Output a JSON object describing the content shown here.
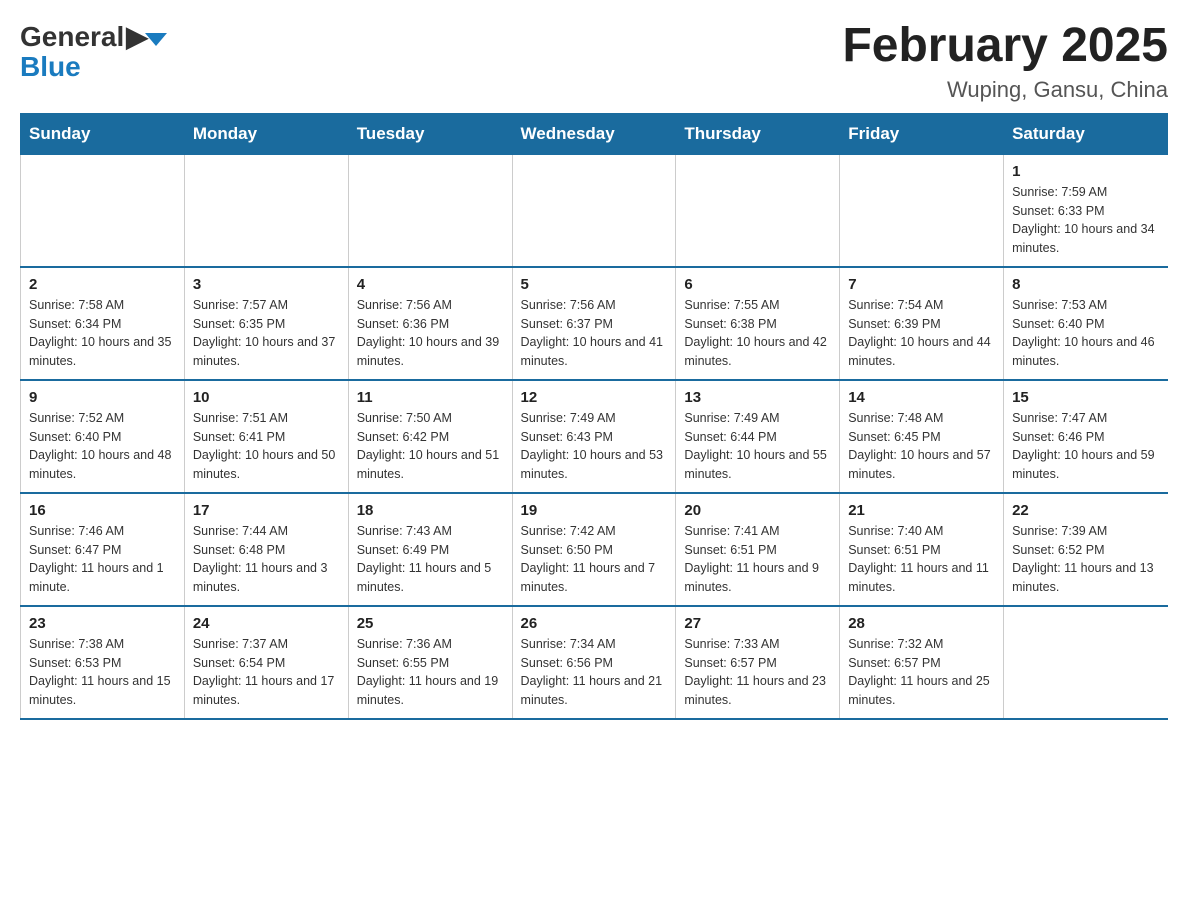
{
  "header": {
    "logo_general": "General",
    "logo_blue": "Blue",
    "month_title": "February 2025",
    "location": "Wuping, Gansu, China"
  },
  "days_of_week": [
    "Sunday",
    "Monday",
    "Tuesday",
    "Wednesday",
    "Thursday",
    "Friday",
    "Saturday"
  ],
  "weeks": [
    [
      {
        "day": "",
        "info": "",
        "empty": true
      },
      {
        "day": "",
        "info": "",
        "empty": true
      },
      {
        "day": "",
        "info": "",
        "empty": true
      },
      {
        "day": "",
        "info": "",
        "empty": true
      },
      {
        "day": "",
        "info": "",
        "empty": true
      },
      {
        "day": "",
        "info": "",
        "empty": true
      },
      {
        "day": "1",
        "info": "Sunrise: 7:59 AM\nSunset: 6:33 PM\nDaylight: 10 hours and 34 minutes."
      }
    ],
    [
      {
        "day": "2",
        "info": "Sunrise: 7:58 AM\nSunset: 6:34 PM\nDaylight: 10 hours and 35 minutes."
      },
      {
        "day": "3",
        "info": "Sunrise: 7:57 AM\nSunset: 6:35 PM\nDaylight: 10 hours and 37 minutes."
      },
      {
        "day": "4",
        "info": "Sunrise: 7:56 AM\nSunset: 6:36 PM\nDaylight: 10 hours and 39 minutes."
      },
      {
        "day": "5",
        "info": "Sunrise: 7:56 AM\nSunset: 6:37 PM\nDaylight: 10 hours and 41 minutes."
      },
      {
        "day": "6",
        "info": "Sunrise: 7:55 AM\nSunset: 6:38 PM\nDaylight: 10 hours and 42 minutes."
      },
      {
        "day": "7",
        "info": "Sunrise: 7:54 AM\nSunset: 6:39 PM\nDaylight: 10 hours and 44 minutes."
      },
      {
        "day": "8",
        "info": "Sunrise: 7:53 AM\nSunset: 6:40 PM\nDaylight: 10 hours and 46 minutes."
      }
    ],
    [
      {
        "day": "9",
        "info": "Sunrise: 7:52 AM\nSunset: 6:40 PM\nDaylight: 10 hours and 48 minutes."
      },
      {
        "day": "10",
        "info": "Sunrise: 7:51 AM\nSunset: 6:41 PM\nDaylight: 10 hours and 50 minutes."
      },
      {
        "day": "11",
        "info": "Sunrise: 7:50 AM\nSunset: 6:42 PM\nDaylight: 10 hours and 51 minutes."
      },
      {
        "day": "12",
        "info": "Sunrise: 7:49 AM\nSunset: 6:43 PM\nDaylight: 10 hours and 53 minutes."
      },
      {
        "day": "13",
        "info": "Sunrise: 7:49 AM\nSunset: 6:44 PM\nDaylight: 10 hours and 55 minutes."
      },
      {
        "day": "14",
        "info": "Sunrise: 7:48 AM\nSunset: 6:45 PM\nDaylight: 10 hours and 57 minutes."
      },
      {
        "day": "15",
        "info": "Sunrise: 7:47 AM\nSunset: 6:46 PM\nDaylight: 10 hours and 59 minutes."
      }
    ],
    [
      {
        "day": "16",
        "info": "Sunrise: 7:46 AM\nSunset: 6:47 PM\nDaylight: 11 hours and 1 minute."
      },
      {
        "day": "17",
        "info": "Sunrise: 7:44 AM\nSunset: 6:48 PM\nDaylight: 11 hours and 3 minutes."
      },
      {
        "day": "18",
        "info": "Sunrise: 7:43 AM\nSunset: 6:49 PM\nDaylight: 11 hours and 5 minutes."
      },
      {
        "day": "19",
        "info": "Sunrise: 7:42 AM\nSunset: 6:50 PM\nDaylight: 11 hours and 7 minutes."
      },
      {
        "day": "20",
        "info": "Sunrise: 7:41 AM\nSunset: 6:51 PM\nDaylight: 11 hours and 9 minutes."
      },
      {
        "day": "21",
        "info": "Sunrise: 7:40 AM\nSunset: 6:51 PM\nDaylight: 11 hours and 11 minutes."
      },
      {
        "day": "22",
        "info": "Sunrise: 7:39 AM\nSunset: 6:52 PM\nDaylight: 11 hours and 13 minutes."
      }
    ],
    [
      {
        "day": "23",
        "info": "Sunrise: 7:38 AM\nSunset: 6:53 PM\nDaylight: 11 hours and 15 minutes."
      },
      {
        "day": "24",
        "info": "Sunrise: 7:37 AM\nSunset: 6:54 PM\nDaylight: 11 hours and 17 minutes."
      },
      {
        "day": "25",
        "info": "Sunrise: 7:36 AM\nSunset: 6:55 PM\nDaylight: 11 hours and 19 minutes."
      },
      {
        "day": "26",
        "info": "Sunrise: 7:34 AM\nSunset: 6:56 PM\nDaylight: 11 hours and 21 minutes."
      },
      {
        "day": "27",
        "info": "Sunrise: 7:33 AM\nSunset: 6:57 PM\nDaylight: 11 hours and 23 minutes."
      },
      {
        "day": "28",
        "info": "Sunrise: 7:32 AM\nSunset: 6:57 PM\nDaylight: 11 hours and 25 minutes."
      },
      {
        "day": "",
        "info": "",
        "empty": true
      }
    ]
  ]
}
